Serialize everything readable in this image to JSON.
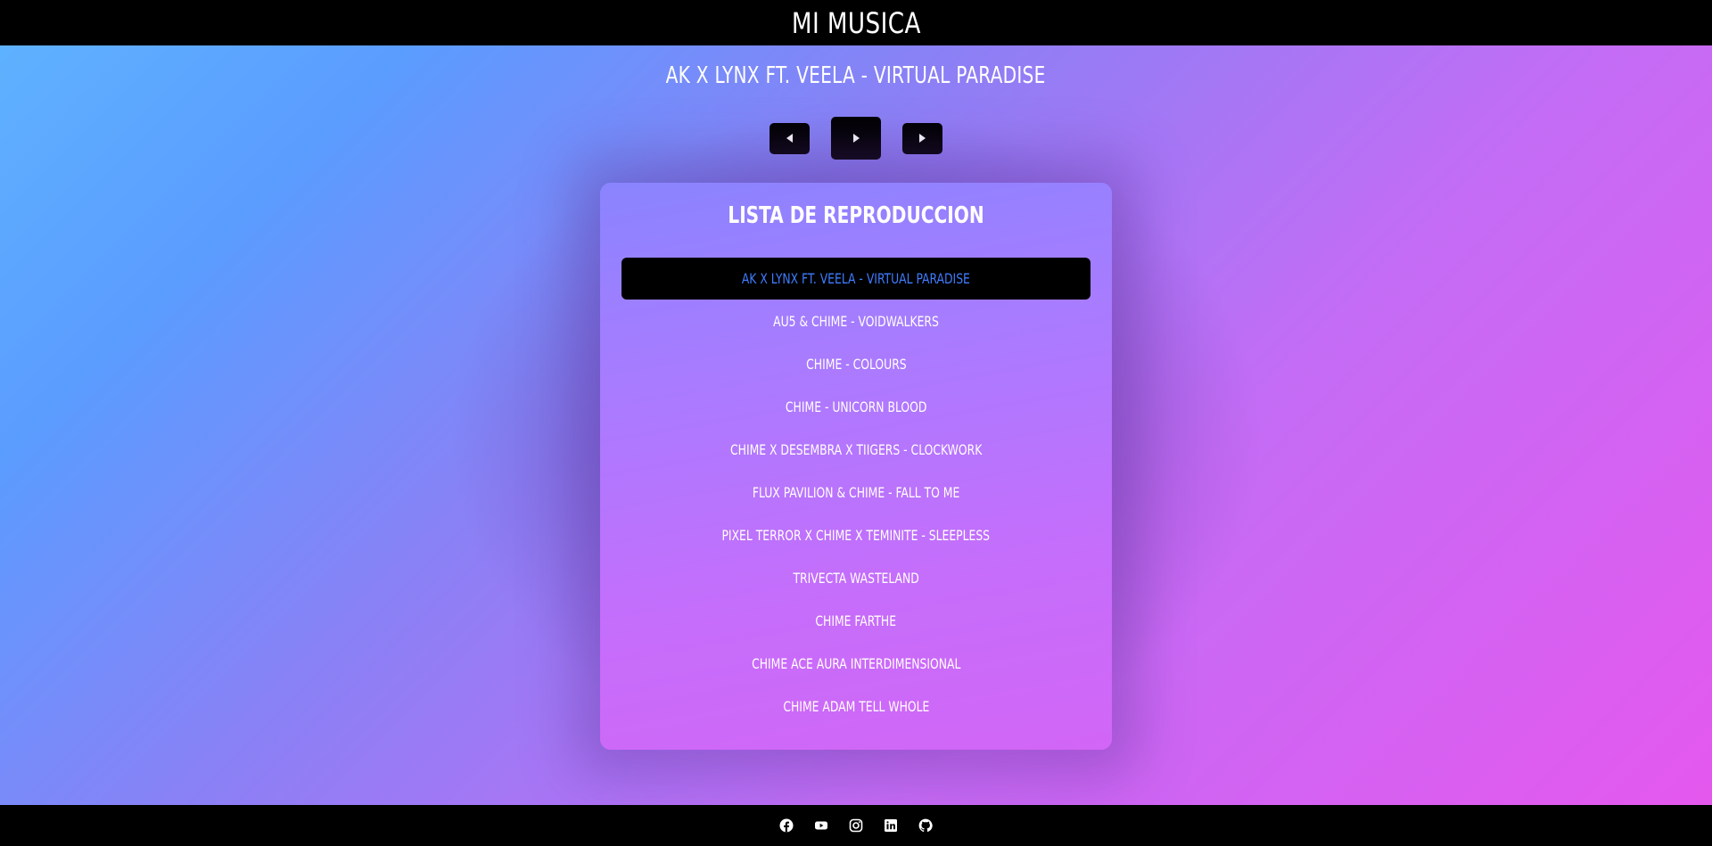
{
  "header": {
    "title": "MI MUSICA"
  },
  "player": {
    "now_playing": "AK X LYNX FT. VEELA - VIRTUAL PARADISE",
    "controls": {
      "prev": "previous-icon",
      "play": "play-icon",
      "next": "next-icon"
    }
  },
  "playlist": {
    "title": "LISTA DE REPRODUCCION",
    "active_index": 0,
    "active_color": "#3f7cff",
    "tracks": [
      "AK X LYNX FT. VEELA - VIRTUAL PARADISE",
      "AU5 & CHIME - VOIDWALKERS",
      "CHIME - COLOURS",
      "CHIME - UNICORN BLOOD",
      "CHIME X DESEMBRA X TIIGERS - CLOCKWORK",
      "FLUX PAVILION & CHIME - FALL TO ME",
      "PIXEL TERROR X CHIME X TEMINITE - SLEEPLESS",
      "TRIVECTA WASTELAND",
      "CHIME FARTHE",
      "CHIME ACE AURA INTERDIMENSIONAL",
      "CHIME ADAM TELL WHOLE"
    ]
  },
  "footer": {
    "social": [
      "facebook-icon",
      "youtube-icon",
      "instagram-icon",
      "linkedin-icon",
      "github-icon"
    ]
  },
  "colors": {
    "bar_background": "#000000",
    "gradient_start": "#5fb4ff",
    "gradient_end": "#e657ee"
  }
}
